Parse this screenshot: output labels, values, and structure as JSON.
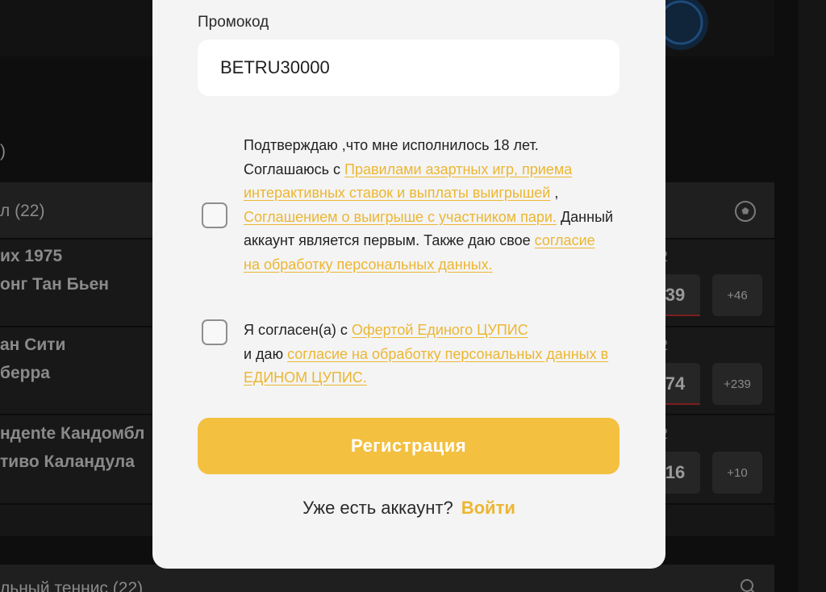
{
  "background": {
    "sections": [
      {
        "title_fragment": ")"
      },
      {
        "title_fragment": "л (22)"
      },
      {
        "title_fragment": "льный теннис (22)"
      }
    ],
    "matches": [
      {
        "team1": "их 1975",
        "team2": "онг Тан Бьен",
        "odd_fragment": "39",
        "odd_label": "2",
        "more": "+46"
      },
      {
        "team1": "ан Сити",
        "team2": "берра",
        "odd_fragment": "74",
        "odd_label": "2",
        "more": "+239"
      },
      {
        "team1": "ндente Кандомбл",
        "team2": "тиво Каландула",
        "odd_fragment": "16",
        "odd_label": "2",
        "more": "+10"
      }
    ]
  },
  "modal": {
    "promo_label": "Промокод",
    "promo_value": "BETRU30000",
    "consent1": {
      "text_a": "Подтверждаю ,что мне исполнилось 18 лет. Соглашаюсь с ",
      "link_a": "Правилами азартных игр, приема интерактивных ставок и выплаты выигрышей",
      "text_b": " , ",
      "link_b": "Соглашением о выигрыше с участником пари.",
      "text_c": " Данный аккаунт является первым. Также даю свое ",
      "link_c": "согласие на обработку персональных данных.",
      "checked": false
    },
    "consent2": {
      "text_a": "Я согласен(а) с ",
      "link_a": "Офертой Единого ЦУПИС",
      "text_b": " и даю ",
      "link_b": "согласие на обработку персональных данных в ЕДИНОМ ЦУПИС.",
      "checked": false
    },
    "register_label": "Регистрация",
    "login_prompt": "Уже есть аккаунт?",
    "login_link": "Войти"
  },
  "colors": {
    "accent": "#F3C040",
    "link": "#ECB632",
    "modal_bg": "#F4F4F4",
    "page_bg": "#0E0E0E"
  },
  "icons": [
    "soccer-ball-icon",
    "search-icon",
    "team-emblem-icon"
  ]
}
